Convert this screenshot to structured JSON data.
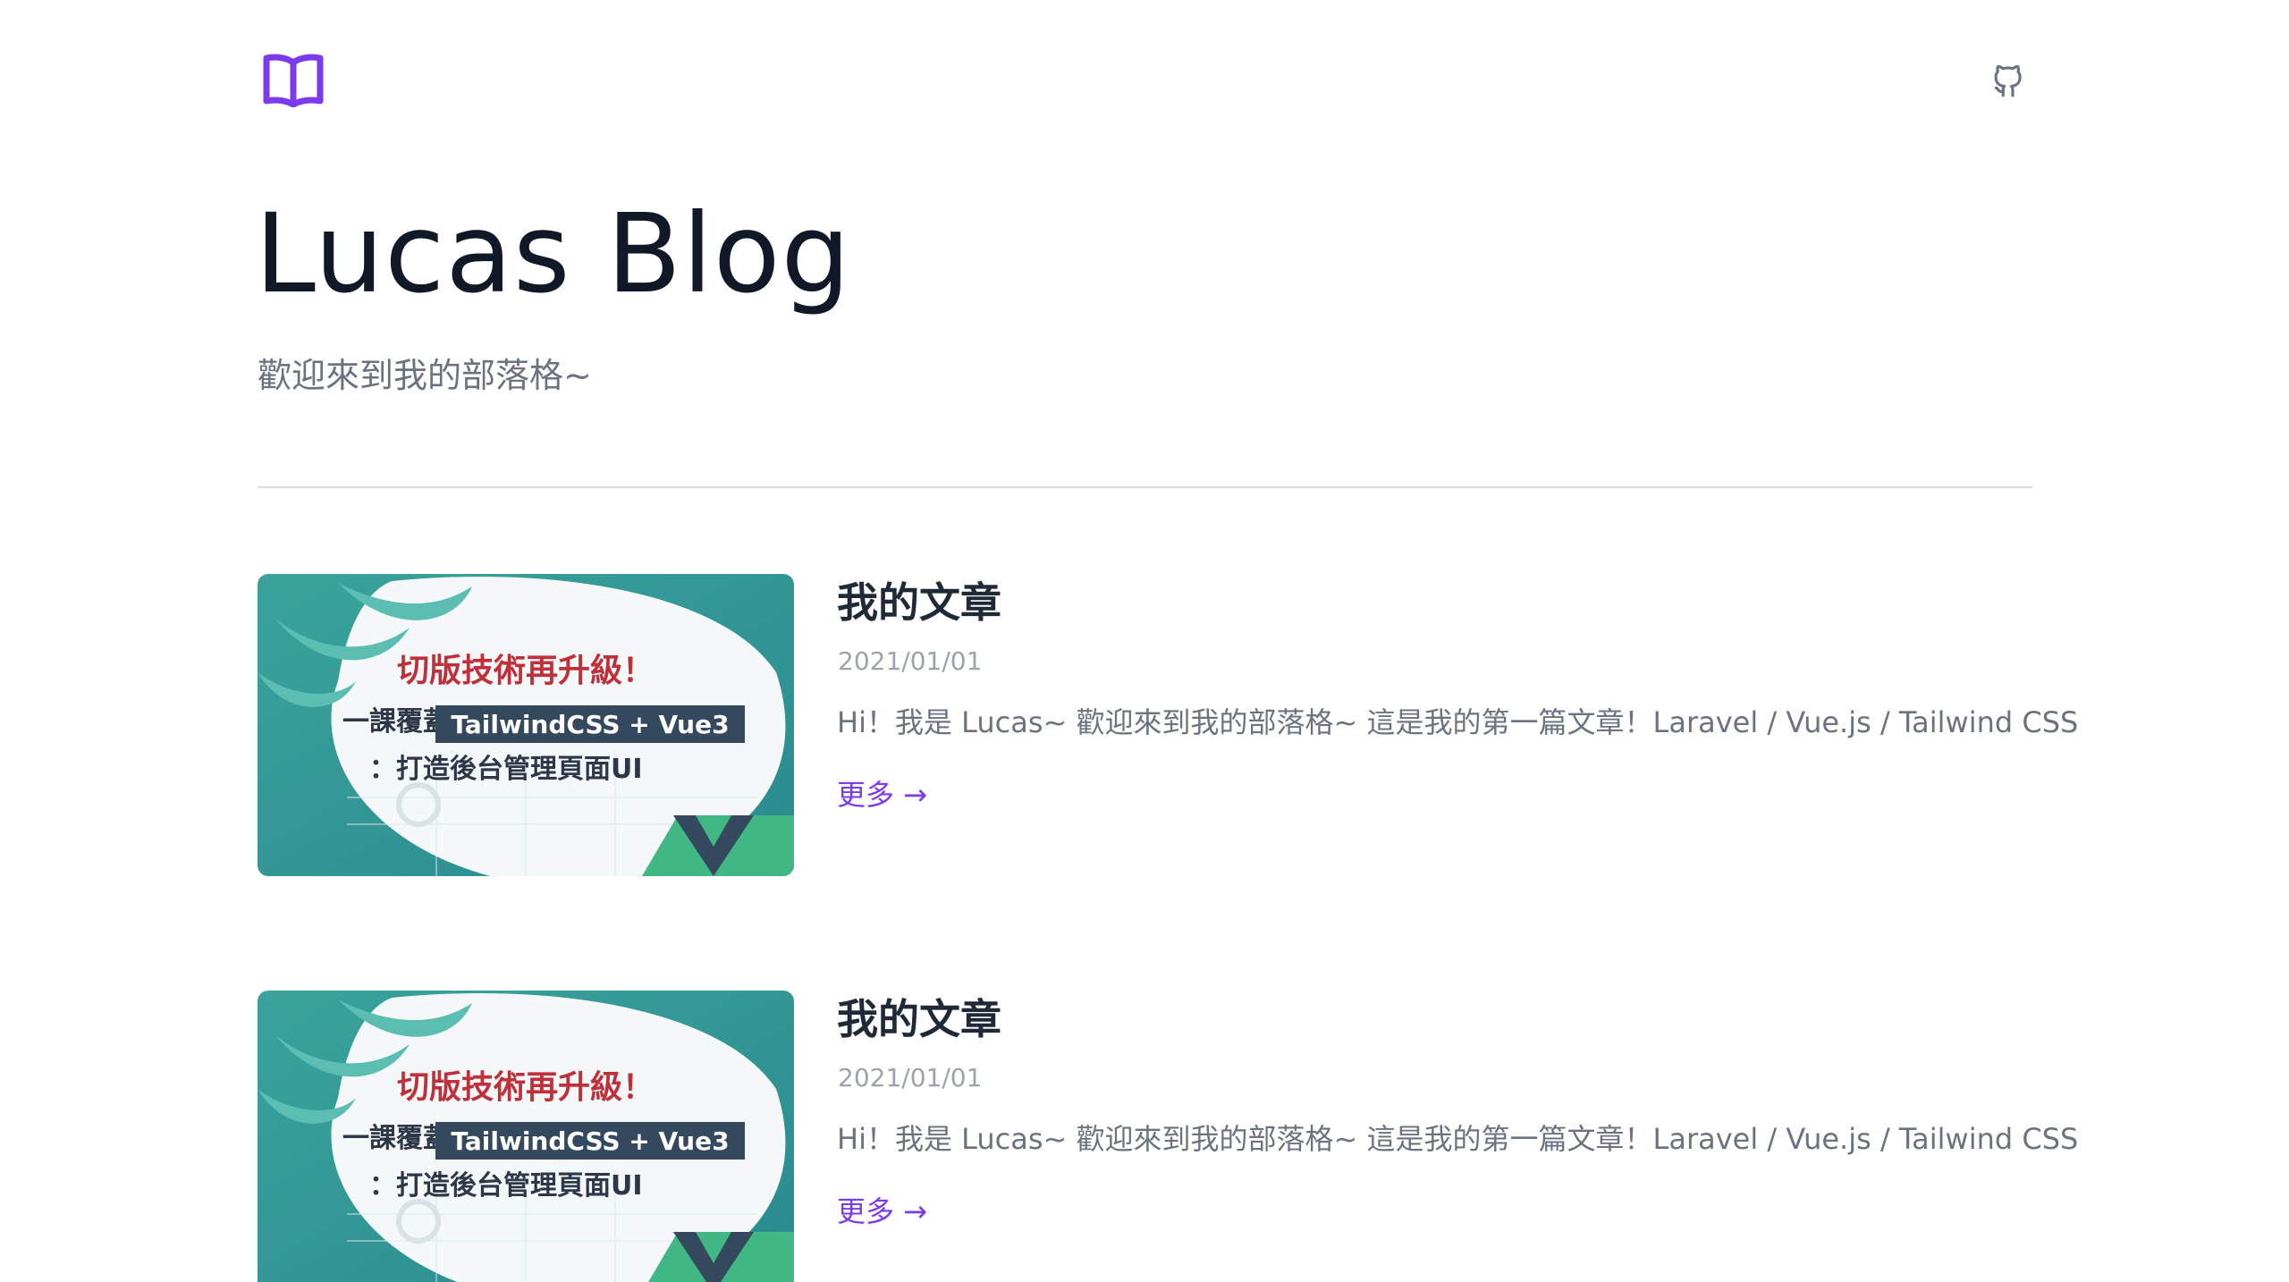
{
  "header": {
    "logo_icon": "book-open-icon",
    "github_icon": "github-icon"
  },
  "blog": {
    "title": "Lucas Blog",
    "subtitle": "歡迎來到我的部落格~"
  },
  "colors": {
    "accent": "#7c3aed",
    "title": "#111827",
    "muted": "#6b7280",
    "banner_red": "#c0303a",
    "banner_dark": "#34495e",
    "banner_teal": "#3aa39b",
    "vue_green": "#41b883"
  },
  "articles": [
    {
      "title": "我的文章",
      "date": "2021/01/01",
      "excerpt": "Hi！我是 Lucas~ 歡迎來到我的部落格~ 這是我的第一篇文章！Laravel / Vue.js / Tailwind CSS",
      "more": "更多 →",
      "thumbnail": {
        "line1": "切版技術再升級！",
        "line2_prefix": "一課覆蓋",
        "line2_highlight": "TailwindCSS + Vue3",
        "line3": "：打造後台管理頁面UI"
      }
    },
    {
      "title": "我的文章",
      "date": "2021/01/01",
      "excerpt": "Hi！我是 Lucas~ 歡迎來到我的部落格~ 這是我的第一篇文章！Laravel / Vue.js / Tailwind CSS",
      "more": "更多 →",
      "thumbnail": {
        "line1": "切版技術再升級！",
        "line2_prefix": "一課覆蓋",
        "line2_highlight": "TailwindCSS + Vue3",
        "line3": "：打造後台管理頁面UI"
      }
    }
  ]
}
